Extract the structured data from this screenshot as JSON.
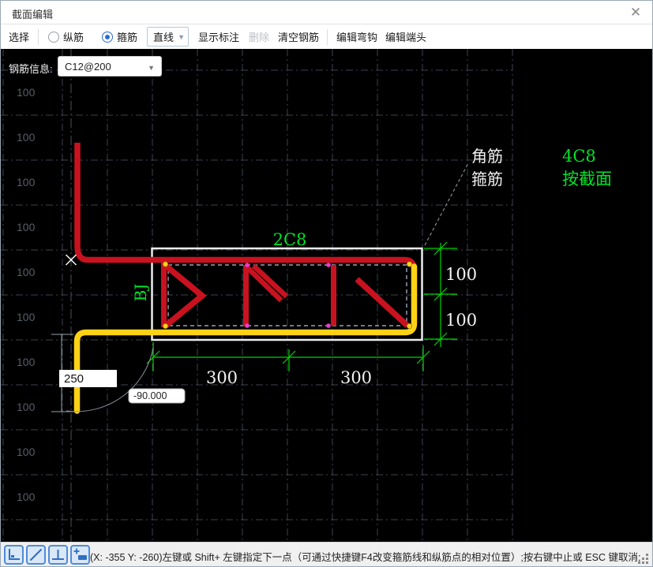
{
  "window": {
    "title": "截面编辑",
    "close_glyph": "✕"
  },
  "toolbar": {
    "select": "选择",
    "radio_longitudinal": "纵筋",
    "radio_stirrup": "箍筋",
    "line_button": "直线",
    "show_annotation": "显示标注",
    "delete": "删除",
    "clear_rebar": "清空钢筋",
    "edit_hook": "编辑弯钩",
    "edit_end": "编辑端头"
  },
  "rebar_info": {
    "label": "钢筋信息:",
    "value": "C12@200"
  },
  "canvas": {
    "left_labels": [
      "100",
      "100",
      "100",
      "100",
      "100",
      "100",
      "100",
      "100",
      "100",
      "100"
    ],
    "top_label": "2C8",
    "bj_label": "BJ",
    "leader_label_1": "角筋",
    "leader_label_2": "箍筋",
    "right_note_1": "4C8",
    "right_note_2": "按截面",
    "dim_right_1": "100",
    "dim_right_2": "100",
    "dim_bottom_1": "300",
    "dim_bottom_2": "300",
    "len_label": "250",
    "angle_label": "-90.000"
  },
  "statusbar": {
    "text": "(X: -355 Y: -260)左键或 Shift+ 左键指定下一点（可通过快捷键F4改变箍筋线和纵筋点的相对位置）;按右键中止或 ESC 键取消;"
  },
  "colors": {
    "rebar_red": "#c9121f",
    "rebar_yellow": "#ffd216",
    "dim_green": "#00d400",
    "green_text": "#00e428",
    "grid": "#3c424c",
    "selection_dash": "#b4c2d8",
    "node_magenta": "#e43fd0",
    "radio_blue": "#2a6bd6",
    "icon_blue": "#4e8cd8"
  }
}
